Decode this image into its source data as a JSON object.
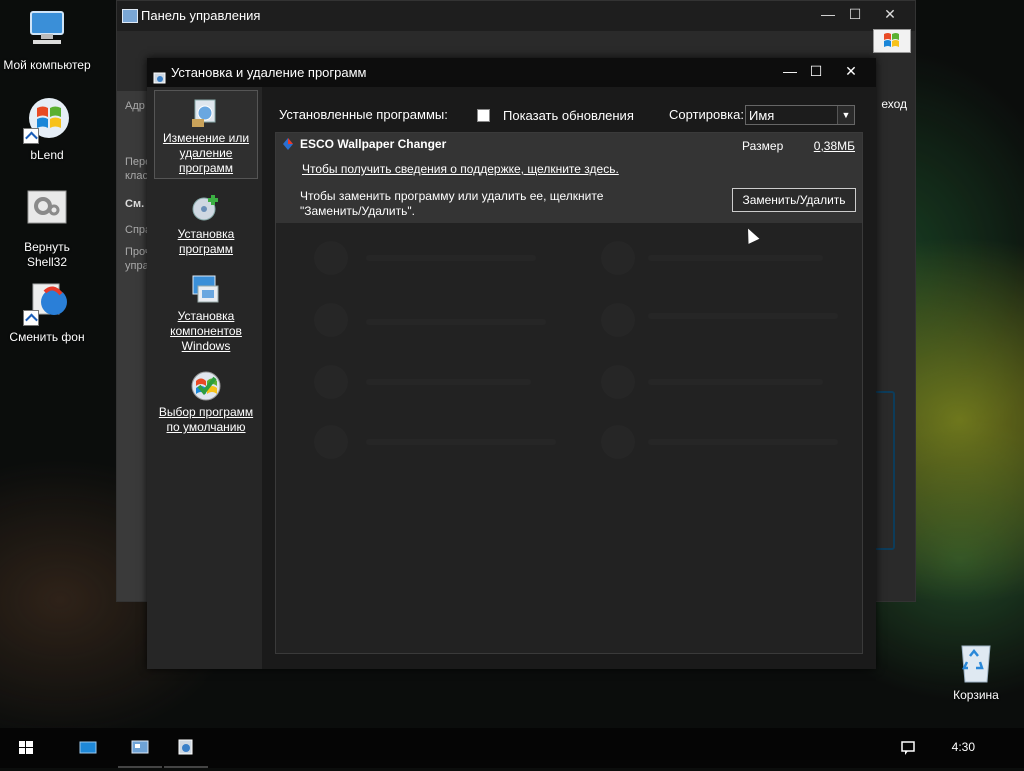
{
  "desktop": {
    "icons": [
      {
        "label": "Мой компьютер"
      },
      {
        "label": "bLend"
      },
      {
        "label": "Вернуть Shell32"
      },
      {
        "label": "Сменить фон"
      },
      {
        "label": "Корзина"
      }
    ]
  },
  "control_panel": {
    "title": "Панель управления",
    "exit_label": "еход"
  },
  "dialog": {
    "title": "Установка и удаление программ",
    "nav": [
      {
        "label": "Изменение или удаление программ"
      },
      {
        "label": "Установка программ"
      },
      {
        "label": "Установка компонентов Windows"
      },
      {
        "label": "Выбор программ по умолчанию"
      }
    ],
    "installed_label": "Установленные программы:",
    "show_updates_label": "Показать обновления",
    "sort_label": "Сортировка:",
    "sort_value": "Имя",
    "program": {
      "name": "ESCO Wallpaper Changer",
      "size_label": "Размер",
      "size_value": "0,38МБ",
      "support_link": "Чтобы получить сведения о поддержке, щелкните здесь.",
      "description": "Чтобы заменить программу или удалить  ее, щелкните \"Заменить/Удалить\".",
      "button_label": "Заменить/Удалить"
    }
  },
  "taskbar": {
    "clock": "4:30"
  },
  "colors": {
    "accent_blue": "#1d5fb8",
    "window_bg": "#1c1c1c",
    "selected_row": "#343434"
  }
}
